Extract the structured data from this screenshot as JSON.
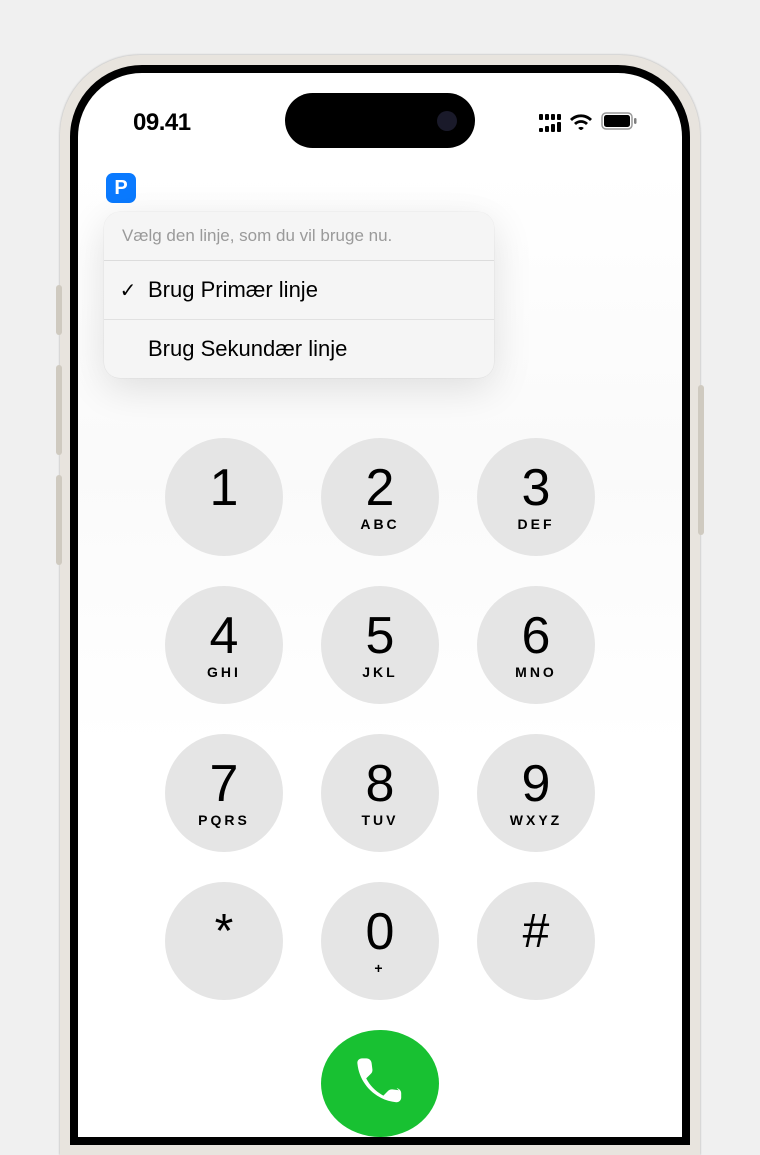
{
  "status": {
    "time": "09.41"
  },
  "line_badge": "P",
  "popover": {
    "header": "Vælg den linje, som du vil bruge nu.",
    "items": [
      {
        "label": "Brug Primær linje",
        "selected": true
      },
      {
        "label": "Brug Sekundær linje",
        "selected": false
      }
    ]
  },
  "keypad": [
    {
      "digit": "1",
      "letters": ""
    },
    {
      "digit": "2",
      "letters": "ABC"
    },
    {
      "digit": "3",
      "letters": "DEF"
    },
    {
      "digit": "4",
      "letters": "GHI"
    },
    {
      "digit": "5",
      "letters": "JKL"
    },
    {
      "digit": "6",
      "letters": "MNO"
    },
    {
      "digit": "7",
      "letters": "PQRS"
    },
    {
      "digit": "8",
      "letters": "TUV"
    },
    {
      "digit": "9",
      "letters": "WXYZ"
    },
    {
      "digit": "*",
      "letters": ""
    },
    {
      "digit": "0",
      "letters": "+"
    },
    {
      "digit": "#",
      "letters": ""
    }
  ],
  "colors": {
    "accent_blue": "#0a7aff",
    "call_green": "#18c132",
    "key_gray": "#e5e5e5"
  }
}
